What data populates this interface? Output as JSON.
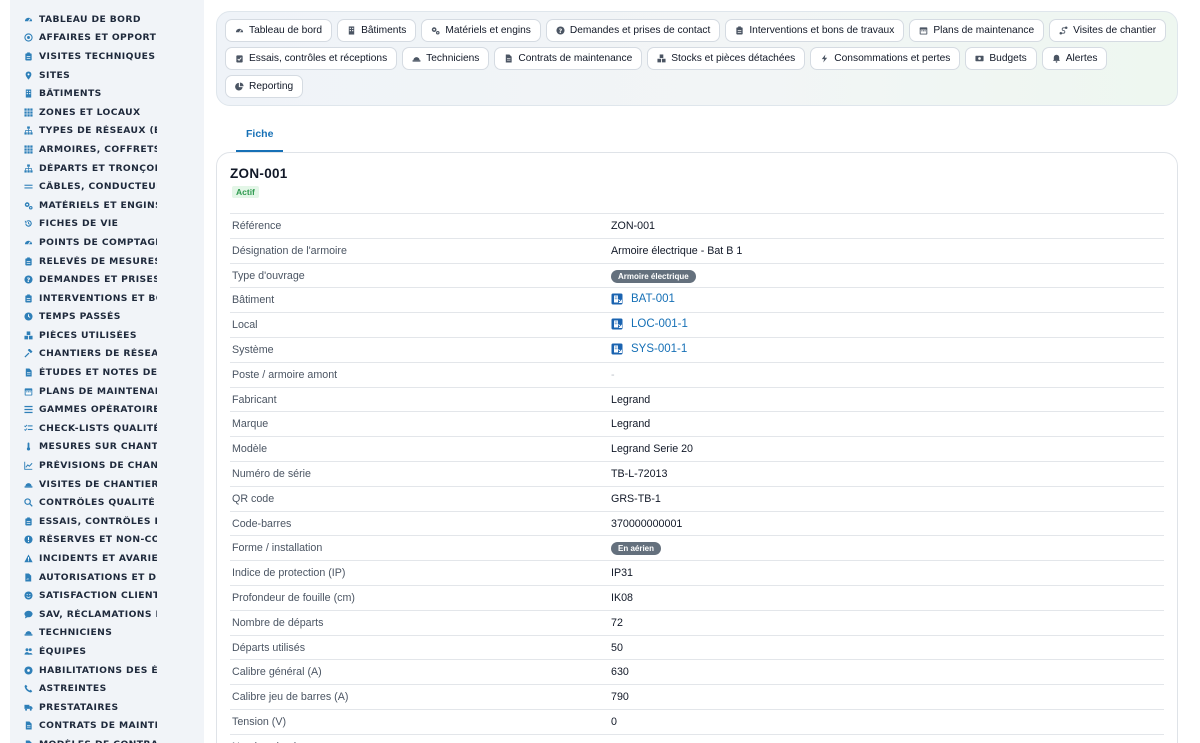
{
  "sidebar": {
    "items": [
      {
        "label": "Tableau de bord",
        "icon": "gauge-icon"
      },
      {
        "label": "Affaires et opportunités",
        "icon": "target-icon"
      },
      {
        "label": "Visites techniques et relevés",
        "icon": "clipboard-icon"
      },
      {
        "label": "Sites",
        "icon": "map-pin-icon"
      },
      {
        "label": "Bâtiments",
        "icon": "building-icon"
      },
      {
        "label": "Zones et locaux",
        "icon": "grid-icon"
      },
      {
        "label": "Types de réseaux (BT / HTA)",
        "icon": "sitemap-icon"
      },
      {
        "label": "Armoires, coffrets et tableaux",
        "icon": "grid-icon"
      },
      {
        "label": "Départs et tronçons",
        "icon": "sitemap-icon"
      },
      {
        "label": "Câbles, conducteurs",
        "icon": "lines-icon"
      },
      {
        "label": "Matériels et engins",
        "icon": "gears-icon"
      },
      {
        "label": "Fiches de vie",
        "icon": "history-icon"
      },
      {
        "label": "Points de comptage et mesure",
        "icon": "gauge-icon"
      },
      {
        "label": "Relevés de mesures",
        "icon": "clipboard-icon"
      },
      {
        "label": "Demandes et prises de contact",
        "icon": "question-icon"
      },
      {
        "label": "Interventions et bons de travaux",
        "icon": "clipboard-icon"
      },
      {
        "label": "Temps passés",
        "icon": "clock-icon"
      },
      {
        "label": "Pièces utilisées",
        "icon": "cubes-icon"
      },
      {
        "label": "Chantiers de réseaux",
        "icon": "hammer-icon"
      },
      {
        "label": "Études et notes de calcul",
        "icon": "file-icon"
      },
      {
        "label": "Plans de maintenance",
        "icon": "calendar-icon"
      },
      {
        "label": "Gammes opératoires",
        "icon": "list-icon"
      },
      {
        "label": "Check-lists qualité",
        "icon": "checklist-icon"
      },
      {
        "label": "Mesures sur chantier",
        "icon": "thermometer-icon"
      },
      {
        "label": "Prévisions de chantier",
        "icon": "chart-icon"
      },
      {
        "label": "Visites de chantier",
        "icon": "helmet-icon"
      },
      {
        "label": "Contrôles qualité",
        "icon": "search-icon"
      },
      {
        "label": "Essais, contrôles et réceptions",
        "icon": "clipboard-icon"
      },
      {
        "label": "Réserves et non-conformités",
        "icon": "alert-circle-icon"
      },
      {
        "label": "Incidents et avaries",
        "icon": "warning-icon"
      },
      {
        "label": "Autorisations et DICT",
        "icon": "file-signature-icon"
      },
      {
        "label": "Satisfaction client",
        "icon": "smile-icon"
      },
      {
        "label": "SAV, réclamations et retours",
        "icon": "comment-icon"
      },
      {
        "label": "Techniciens",
        "icon": "helmet-icon"
      },
      {
        "label": "Équipes",
        "icon": "users-icon"
      },
      {
        "label": "Habilitations des équipes",
        "icon": "badge-icon"
      },
      {
        "label": "Astreintes",
        "icon": "phone-icon"
      },
      {
        "label": "Prestataires",
        "icon": "truck-icon"
      },
      {
        "label": "Contrats de maintenance",
        "icon": "file-icon"
      },
      {
        "label": "Modèles de contrats",
        "icon": "file-icon"
      }
    ]
  },
  "nav": {
    "buttons": [
      {
        "label": "Tableau de bord",
        "icon": "gauge-icon"
      },
      {
        "label": "Bâtiments",
        "icon": "building-icon"
      },
      {
        "label": "Matériels et engins",
        "icon": "gears-icon"
      },
      {
        "label": "Demandes et prises de contact",
        "icon": "question-icon"
      },
      {
        "label": "Interventions et bons de travaux",
        "icon": "clipboard-icon"
      },
      {
        "label": "Plans de maintenance",
        "icon": "calendar-icon"
      },
      {
        "label": "Visites de chantier",
        "icon": "route-icon"
      },
      {
        "label": "Essais, contrôles et réceptions",
        "icon": "clipboard-check-icon"
      },
      {
        "label": "Techniciens",
        "icon": "helmet-icon"
      },
      {
        "label": "Contrats de maintenance",
        "icon": "file-icon"
      },
      {
        "label": "Stocks et pièces détachées",
        "icon": "cubes-icon"
      },
      {
        "label": "Consommations et pertes",
        "icon": "bolt-icon"
      },
      {
        "label": "Budgets",
        "icon": "money-icon"
      },
      {
        "label": "Alertes",
        "icon": "bell-icon"
      },
      {
        "label": "Reporting",
        "icon": "pie-chart-icon"
      }
    ]
  },
  "tabs": {
    "fiche": "Fiche"
  },
  "card": {
    "title": "ZON-001",
    "status": "Actif",
    "rows": [
      {
        "label": "Référence",
        "value": "ZON-001",
        "kind": "text"
      },
      {
        "label": "Désignation de l'armoire",
        "value": "Armoire électrique - Bat B 1",
        "kind": "text"
      },
      {
        "label": "Type d'ouvrage",
        "value": "Armoire électrique",
        "kind": "pill"
      },
      {
        "label": "Bâtiment",
        "value": "BAT-001",
        "kind": "link"
      },
      {
        "label": "Local",
        "value": "LOC-001-1",
        "kind": "link"
      },
      {
        "label": "Système",
        "value": "SYS-001-1",
        "kind": "link"
      },
      {
        "label": "Poste / armoire amont",
        "value": "-",
        "kind": "muted"
      },
      {
        "label": "Fabricant",
        "value": "Legrand",
        "kind": "text"
      },
      {
        "label": "Marque",
        "value": "Legrand",
        "kind": "text"
      },
      {
        "label": "Modèle",
        "value": "Legrand Serie 20",
        "kind": "text"
      },
      {
        "label": "Numéro de série",
        "value": "TB-L-72013",
        "kind": "text"
      },
      {
        "label": "QR code",
        "value": "GRS-TB-1",
        "kind": "text"
      },
      {
        "label": "Code-barres",
        "value": "370000000001",
        "kind": "text"
      },
      {
        "label": "Forme / installation",
        "value": "En aérien",
        "kind": "pill"
      },
      {
        "label": "Indice de protection (IP)",
        "value": "IP31",
        "kind": "text"
      },
      {
        "label": "Profondeur de fouille (cm)",
        "value": "IK08",
        "kind": "text"
      },
      {
        "label": "Nombre de départs",
        "value": "72",
        "kind": "text"
      },
      {
        "label": "Départs utilisés",
        "value": "50",
        "kind": "text"
      },
      {
        "label": "Calibre général (A)",
        "value": "630",
        "kind": "text"
      },
      {
        "label": "Calibre jeu de barres (A)",
        "value": "790",
        "kind": "text"
      },
      {
        "label": "Tension (V)",
        "value": "0",
        "kind": "text"
      },
      {
        "label": "Nombre de phases",
        "value": "",
        "kind": "text"
      }
    ]
  }
}
